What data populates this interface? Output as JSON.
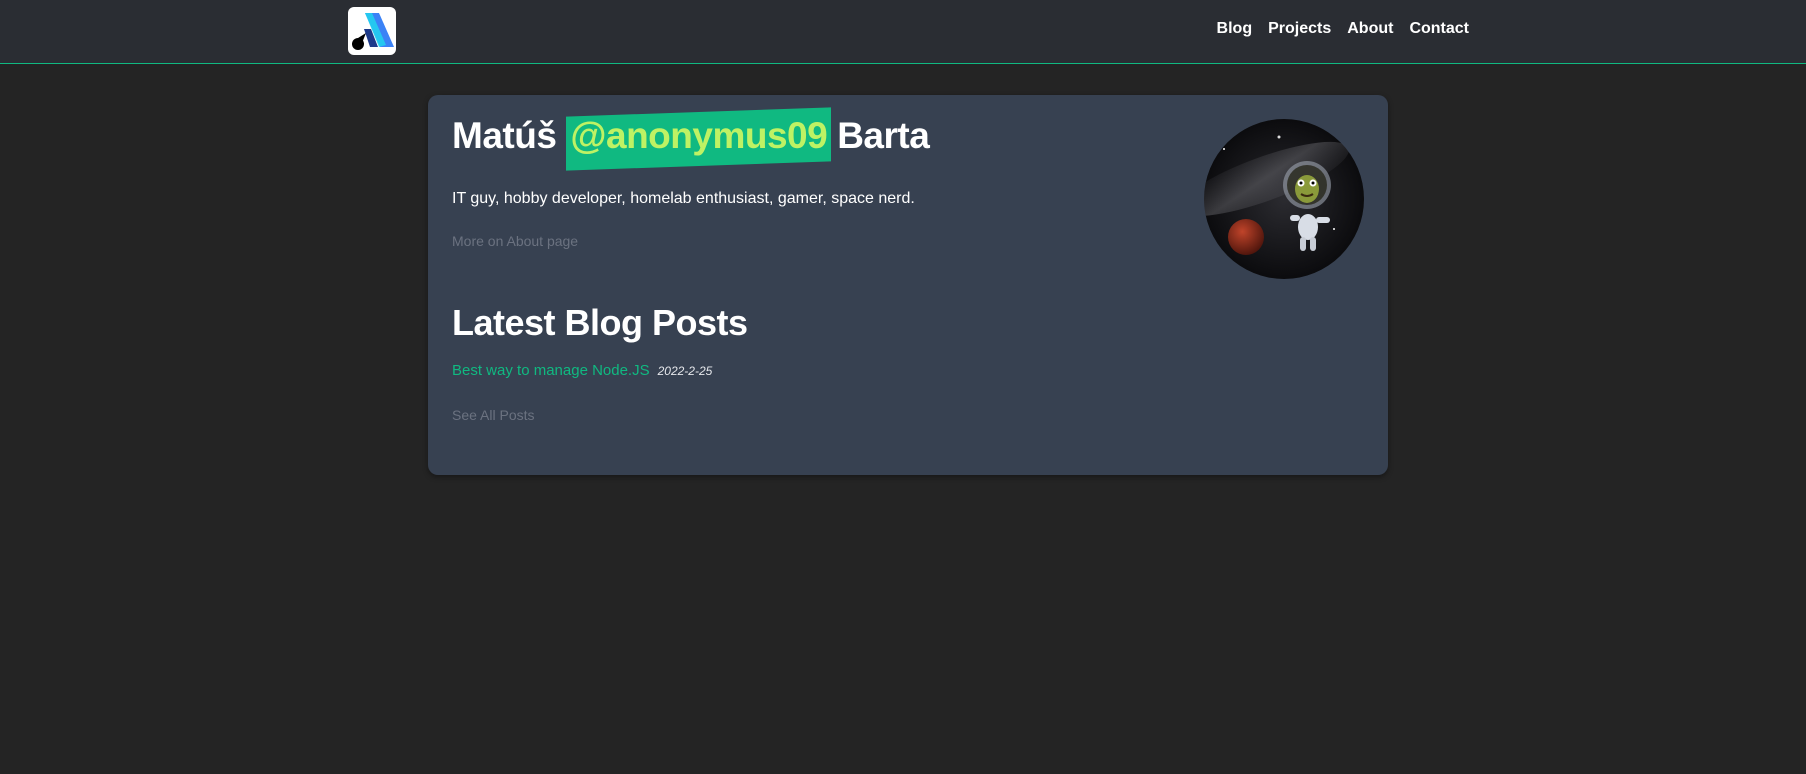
{
  "header": {
    "logo_icon": "site-logo-icon",
    "nav": [
      {
        "label": "Blog"
      },
      {
        "label": "Projects"
      },
      {
        "label": "About"
      },
      {
        "label": "Contact"
      }
    ]
  },
  "profile": {
    "first_name": "Matúš",
    "handle": "@anonymus09",
    "last_name": "Barta",
    "bio": "IT guy, hobby developer, homelab enthusiast, gamer, space nerd.",
    "about_link": "More on About page",
    "avatar_icon": "astronaut-avatar"
  },
  "blog": {
    "title": "Latest Blog Posts",
    "posts": [
      {
        "title": "Best way to manage Node.JS",
        "date": "2022-2-25"
      }
    ],
    "see_all": "See All Posts"
  },
  "colors": {
    "background": "#242424",
    "header": "#2a2d33",
    "card": "#374151",
    "accent": "#10b981",
    "handle_text": "#bef264",
    "muted": "#6b7280"
  }
}
